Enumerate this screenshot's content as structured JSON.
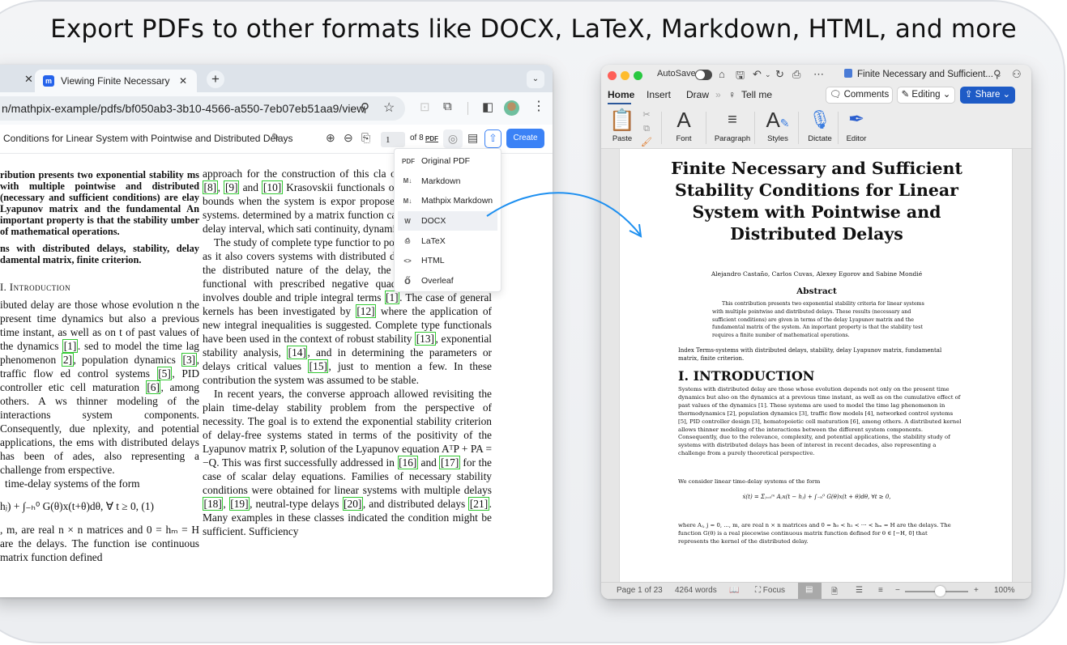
{
  "headline": "Export PDFs to other formats like DOCX, LaTeX, Markdown, HTML, and more",
  "browser": {
    "tabs": [
      {
        "title": "Viewing Finite Necessary and Sufficient Stability Conditions",
        "favicon": "mathpix-icon",
        "active": true
      }
    ],
    "url": "n/mathpix-example/pdfs/bf050ab3-3b10-4566-a550-7eb07eb51aa9/view",
    "toolbar": {
      "doc_title": "Conditions for Linear System with Pointwise and Distributed Delays",
      "page_current": "1",
      "page_total_label": "of 8",
      "pdf_label": "PDF",
      "create_label": "Create"
    },
    "export_menu": {
      "items": [
        {
          "label": "Original PDF",
          "icon": "pdf-file-icon",
          "active": false
        },
        {
          "label": "Markdown",
          "icon": "markdown-icon",
          "active": false
        },
        {
          "label": "Mathpix Markdown",
          "icon": "markdown-icon",
          "active": false
        },
        {
          "label": "DOCX",
          "icon": "word-file-icon",
          "active": true
        },
        {
          "label": "LaTeX",
          "icon": "latex-file-icon",
          "active": false
        },
        {
          "label": "HTML",
          "icon": "html-file-icon",
          "active": false
        },
        {
          "label": "Overleaf",
          "icon": "overleaf-icon",
          "active": false
        }
      ]
    },
    "pdf": {
      "abstract": "ribution presents two exponential stability ms with multiple pointwise and distributed (necessary and sufficient conditions) are elay Lyapunov matrix and the fundamental An important property is that the stability umber of mathematical operations.",
      "keywords": "ns with distributed delays, stability, delay damental matrix, finite criterion.",
      "intro_heading": "I. Introduction",
      "left_para_parts": [
        "ibuted delay are those whose evolution n the present time dynamics but also a previous time instant, as well as on t of past values of the dynamics ",
        "[1]",
        ". sed to model the time lag phenomenon ",
        "2]",
        ", population dynamics ",
        "[3]",
        ", traffic flow ed control systems ",
        "[5]",
        ", PID controller etic cell maturation ",
        "[6]",
        ", among others. A ws thinner modeling of the interactions system components. Consequently, due nplexity, and potential applications, the ems with distributed delays has been of ades, also representing a challenge from erspective."
      ],
      "left_form_line": "time-delay systems of the form",
      "left_equation": "hⱼ) + ∫₋ₕ⁰ G(θ)x(t+θ)dθ, ∀ t ≥ 0, (1)",
      "left_after_eq": ", m, are real n × n matrices and 0 = hₘ = H are the delays. The function ise continuous matrix function defined",
      "right_para1_parts": [
        "approach for the construction of this cla originally presented in ",
        "[8]",
        ", ",
        "[9]",
        " and ",
        "[10]",
        " Krasovskii functionals of complete type lower bounds when the system is expor proposed for pointwise delay systems. determined by a matrix function called de defined on the delay interval, which sati continuity, dynamic, symmetric, and alg"
      ],
      "right_para2_parts": [
        "The study of complete type functior to pointwise delay systems, as it also covers systems with distributed delays ",
        "[1]",
        ". Because of the distributed nature of the delay, the Lyapunov-Krasovskii functional with prescribed negative quadratic derivative now involves double and triple integral terms ",
        "[1]",
        ". The case of general kernels has been investigated by ",
        "[12]",
        " where the application of new integral inequalities is suggested. Complete type functionals have been used in the context of robust stability ",
        "[13]",
        ", exponential stability analysis, ",
        "[14]",
        ", and in determining the parameters or delays critical values ",
        "[15]",
        ", just to mention a few. In these contribution the system was assumed to be stable."
      ],
      "right_para3_parts": [
        "In recent years, the converse approach allowed revisiting the plain time-delay stability problem from the perspective of necessity. The goal is to extend the exponential stability criterion of delay-free systems stated in terms of the positivity of the Lyapunov matrix P, solution of the Lyapunov equation AᵀP + PA = −Q. This was first successfully addressed in ",
        "[16]",
        " and ",
        "[17]",
        " for the case of scalar delay equations. Families of necessary stability conditions were obtained for linear systems with multiple delays ",
        "[18]",
        ", ",
        "[19]",
        ", neutral-type delays ",
        "[20]",
        ", and distributed delays ",
        "[21]",
        ". Many examples in these classes indicated the condition might be sufficient. Sufficiency"
      ]
    }
  },
  "word": {
    "autosave_label": "AutoSave",
    "filename": "Finite Necessary and Sufficient...",
    "ribbon_tabs": [
      "Home",
      "Insert",
      "Draw",
      "Tell me"
    ],
    "buttons": {
      "comments": "Comments",
      "editing": "Editing",
      "share": "Share"
    },
    "ribbon_groups": [
      {
        "label": "Paste",
        "icon": "clipboard-icon"
      },
      {
        "label": "Font",
        "icon": "font-icon"
      },
      {
        "label": "Paragraph",
        "icon": "paragraph-icon"
      },
      {
        "label": "Styles",
        "icon": "styles-icon"
      },
      {
        "label": "Dictate",
        "icon": "microphone-icon"
      },
      {
        "label": "Editor",
        "icon": "editor-pen-icon"
      }
    ],
    "doc": {
      "title": "Finite Necessary and Sufficient Stability Conditions for Linear System with Pointwise and Distributed Delays",
      "authors": "Alejandro Castaño, Carlos Cuvas, Alexey Egorov and Sabine Mondié",
      "abstract_heading": "Abstract",
      "abstract": "This contribution presents two exponential stability criteria for linear systems with multiple pointwise and distributed delays. These results (necessary and sufficient conditions) are given in terms of the delay Lyapunov matrix and the fundamental matrix of the system. An important property is that the stability test requires a finite number of mathematical operations.",
      "index_terms": "Index Terms-systems with distributed delays, stability, delay Lyapunov matrix, fundamental matrix, finite criterion.",
      "section_heading": "I. INTRODUCTION",
      "intro": "Systems with distributed delay are those whose evolution depends not only on the present time dynamics but also on the dynamics at a previous time instant, as well as on the cumulative effect of past values of the dynamics [1]. These systems are used to model the time lag phenomenon in thermodynamics [2], population dynamics [3], traffic flow models [4], networked control systems [5], PID controller design [3], hematopoietic cell maturation [6], among others. A distributed kernel allows thinner modeling of the interactions between the different system components. Consequently, due to the relevance, complexity, and potential applications, the stability study of systems with distributed delays has been of interest in recent decades, also representing a challenge from a purely theoretical perspective.",
      "consider": "We consider linear time-delay systems of the form",
      "equation": "ẋ(t) = Σⱼ₌₀ᵐ Aⱼx(t − hⱼ) + ∫₋ₕ⁰ G(θ)x(t + θ)dθ, ∀t ≥ 0,",
      "where": "where Aⱼ, j = 0, ..., m, are real n × n matrices and 0 = h₀ < h₁ < ⋯ < hₘ = H are the delays. The function G(θ) is a real piecewise continuous matrix function defined for θ ∈ [−H, 0] that represents the kernel of the distributed delay."
    },
    "status": {
      "page": "Page 1 of 23",
      "words": "4264 words",
      "focus": "Focus",
      "zoom_minus": "−",
      "zoom_plus": "+",
      "zoom_level": "100%",
      "zoom_percent": 100
    }
  },
  "colors": {
    "accent_blue": "#3b82f6",
    "share_blue": "#1e5bc6",
    "citation_green": "#32c832",
    "arrow_blue": "#1d8ff0"
  }
}
